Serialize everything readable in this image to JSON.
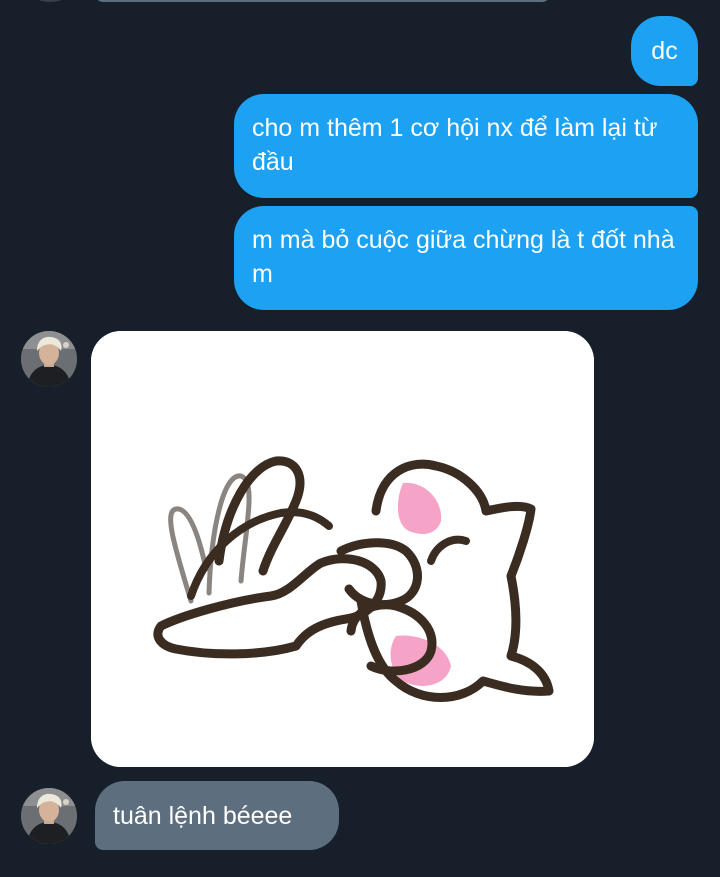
{
  "conversation": {
    "messages": [
      {
        "direction": "outgoing",
        "text": "dc"
      },
      {
        "direction": "outgoing",
        "text": "cho m thêm 1 cơ hội nx để làm lại từ đầu"
      },
      {
        "direction": "outgoing",
        "text": "m mà bỏ cuộc giữa chừng là t đốt nhà m"
      },
      {
        "direction": "incoming",
        "type": "sticker",
        "sticker": "cat-paw-waving-sticker"
      },
      {
        "direction": "incoming",
        "text": "tuân lệnh béeee"
      }
    ]
  },
  "colors": {
    "background": "#17202a",
    "outgoing_bubble": "#1da1f2",
    "incoming_bubble": "#5d6f7f",
    "text": "#ffffff"
  }
}
